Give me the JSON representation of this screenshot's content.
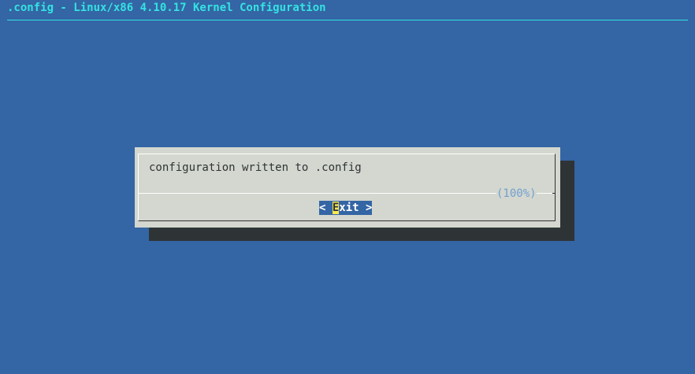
{
  "header": {
    "title": ".config - Linux/x86 4.10.17 Kernel Configuration"
  },
  "dialog": {
    "message": "configuration written to .config",
    "progress_text": "(100%)",
    "exit_button": {
      "left_bracket": "< ",
      "hotkey": "E",
      "rest": "xit",
      "right_bracket": " >"
    }
  },
  "colors": {
    "background": "#3465a4",
    "title": "#34e2e2",
    "dialog": "#d3d7cf",
    "shadow": "#2e3436",
    "hotkey_highlight": "#fce94f",
    "progress": "#729fcf"
  }
}
